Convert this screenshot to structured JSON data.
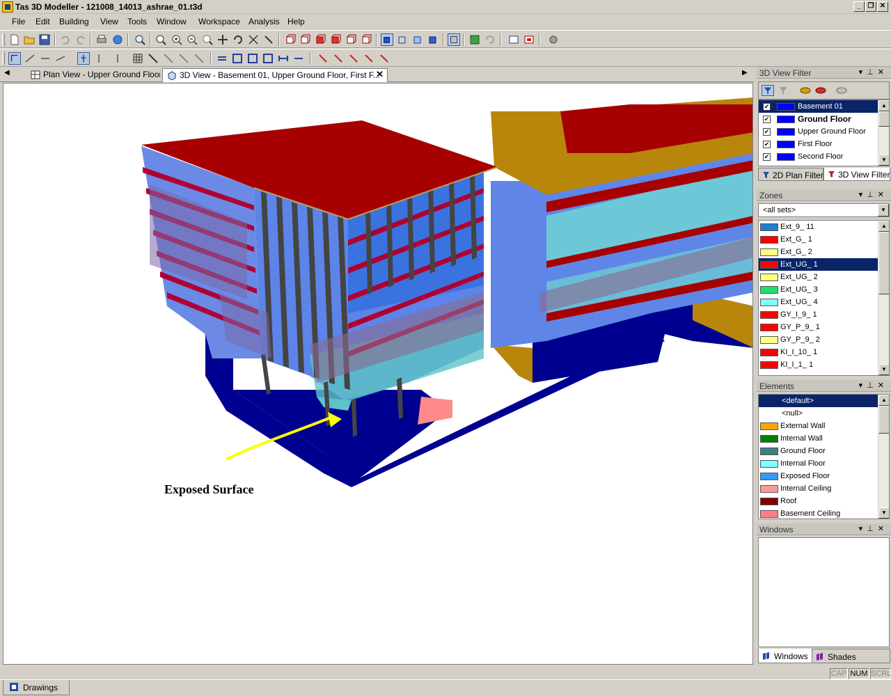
{
  "window": {
    "title": "Tas 3D Modeller - 121008_14013_ashrae_01.t3d"
  },
  "menu": [
    "File",
    "Edit",
    "Building",
    "View",
    "Tools",
    "Window",
    "Workspace",
    "Analysis",
    "Help"
  ],
  "tabs": [
    {
      "label": "Plan View - Upper Ground Floor",
      "active": false
    },
    {
      "label": "3D View - Basement 01, Upper Ground Floor, First F...",
      "active": true
    }
  ],
  "viewport": {
    "annotation": "Exposed Surface",
    "annotation_color": "#ffff00"
  },
  "view_filter": {
    "title": "3D View Filter",
    "items": [
      {
        "label": "Basement 01",
        "checked": true,
        "selected": true,
        "bold": false,
        "color": "#0000ff"
      },
      {
        "label": "Ground Floor",
        "checked": true,
        "selected": false,
        "bold": true,
        "color": "#0000ff"
      },
      {
        "label": "Upper Ground Floor",
        "checked": true,
        "selected": false,
        "bold": false,
        "color": "#0000ff"
      },
      {
        "label": "First Floor",
        "checked": true,
        "selected": false,
        "bold": false,
        "color": "#0000ff"
      },
      {
        "label": "Second Floor",
        "checked": true,
        "selected": false,
        "bold": false,
        "color": "#0000ff"
      }
    ],
    "tab_2d": "2D Plan Filter",
    "tab_3d": "3D View Filter"
  },
  "zones": {
    "title": "Zones",
    "set": "<all sets>",
    "items": [
      {
        "label": "Ext_9_ 11",
        "color": "#1e7fcf",
        "selected": false
      },
      {
        "label": "Ext_G_ 1",
        "color": "#ff0000",
        "selected": false
      },
      {
        "label": "Ext_G_ 2",
        "color": "#ffff80",
        "selected": false
      },
      {
        "label": "Ext_UG_ 1",
        "color": "#ff0000",
        "selected": true
      },
      {
        "label": "Ext_UG_ 2",
        "color": "#ffff80",
        "selected": false
      },
      {
        "label": "Ext_UG_ 3",
        "color": "#20e070",
        "selected": false
      },
      {
        "label": "Ext_UG_ 4",
        "color": "#80ffff",
        "selected": false
      },
      {
        "label": "GY_I_9_ 1",
        "color": "#ff0000",
        "selected": false
      },
      {
        "label": "GY_P_9_ 1",
        "color": "#ff0000",
        "selected": false
      },
      {
        "label": "GY_P_9_ 2",
        "color": "#ffff80",
        "selected": false
      },
      {
        "label": "KI_I_10_ 1",
        "color": "#ff0000",
        "selected": false
      },
      {
        "label": "KI_I_1_ 1",
        "color": "#ff0000",
        "selected": false
      }
    ]
  },
  "elements": {
    "title": "Elements",
    "items": [
      {
        "label": "<default>",
        "color": null,
        "selected": true
      },
      {
        "label": "<null>",
        "color": null,
        "selected": false
      },
      {
        "label": "External Wall",
        "color": "#ffa500",
        "selected": false
      },
      {
        "label": "Internal Wall",
        "color": "#008000",
        "selected": false
      },
      {
        "label": "Ground Floor",
        "color": "#408080",
        "selected": false
      },
      {
        "label": "Internal Floor",
        "color": "#80ffff",
        "selected": false
      },
      {
        "label": "Exposed Floor",
        "color": "#3399ff",
        "selected": false
      },
      {
        "label": "Internal Ceiling",
        "color": "#ff9999",
        "selected": false
      },
      {
        "label": "Roof",
        "color": "#800000",
        "selected": false
      },
      {
        "label": "Basement Ceiling",
        "color": "#ff8080",
        "selected": false
      }
    ]
  },
  "windows_panel": {
    "title": "Windows"
  },
  "bottom_tabs": {
    "windows": "Windows",
    "shades": "Shades"
  },
  "status": {
    "drawings": "Drawings",
    "cap": "CAP",
    "num": "NUM",
    "scrl": "SCRL"
  }
}
